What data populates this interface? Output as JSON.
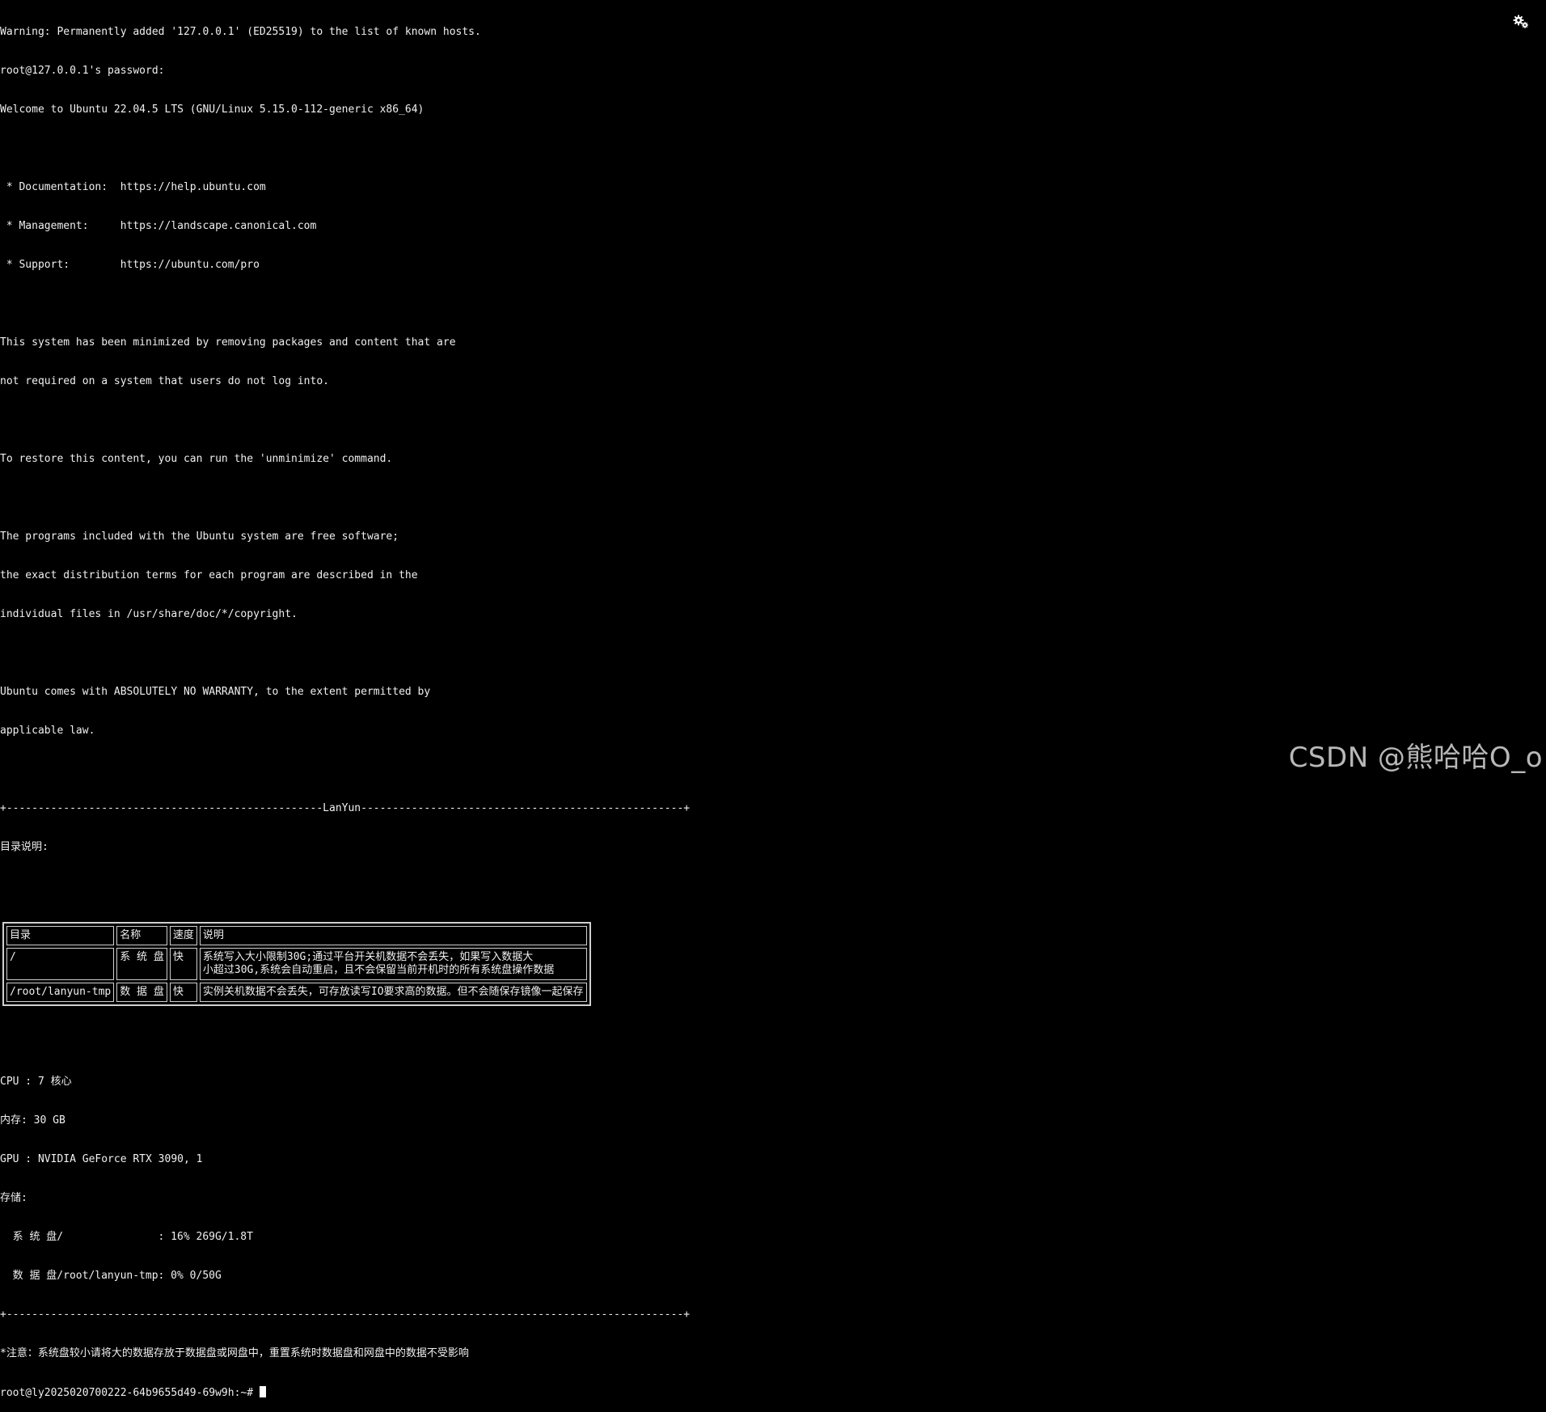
{
  "terminal": {
    "lines_top": [
      "Warning: Permanently added '127.0.0.1' (ED25519) to the list of known hosts.",
      "root@127.0.0.1's password:",
      "Welcome to Ubuntu 22.04.5 LTS (GNU/Linux 5.15.0-112-generic x86_64)",
      "",
      " * Documentation:  https://help.ubuntu.com",
      " * Management:     https://landscape.canonical.com",
      " * Support:        https://ubuntu.com/pro",
      "",
      "This system has been minimized by removing packages and content that are",
      "not required on a system that users do not log into.",
      "",
      "To restore this content, you can run the 'unminimize' command.",
      "",
      "The programs included with the Ubuntu system are free software;",
      "the exact distribution terms for each program are described in the",
      "individual files in /usr/share/doc/*/copyright.",
      "",
      "Ubuntu comes with ABSOLUTELY NO WARRANTY, to the extent permitted by",
      "applicable law.",
      "",
      "+--------------------------------------------------LanYun---------------------------------------------------+",
      "目录说明:"
    ],
    "table": {
      "headers": [
        "目录",
        "名称",
        "速度",
        "说明"
      ],
      "rows": [
        [
          "/",
          "系 统 盘",
          "快",
          "系统写入大小限制30G;通过平台开关机数据不会丢失，如果写入数据大\n小超过30G,系统会自动重启，且不会保留当前开机时的所有系统盘操作数据"
        ],
        [
          "/root/lanyun-tmp",
          "数 据 盘",
          "快",
          "实例关机数据不会丢失，可存放读写IO要求高的数据。但不会随保存镜像一起保存"
        ]
      ]
    },
    "lines_bottom": [
      "CPU : 7 核心",
      "内存: 30 GB",
      "GPU : NVIDIA GeForce RTX 3090, 1",
      "存储:",
      "  系 统 盘/               : 16% 269G/1.8T",
      "  数 据 盘/root/lanyun-tmp: 0% 0/50G",
      "+-----------------------------------------------------------------------------------------------------------+",
      "*注意：系统盘较小请将大的数据存放于数据盘或网盘中，重置系统时数据盘和网盘中的数据不受影响"
    ],
    "prompt": "root@ly2025020700222-64b9655d49-69w9h:~# "
  },
  "settings_icon": "gears-icon",
  "watermark": "CSDN @熊哈哈O_o"
}
